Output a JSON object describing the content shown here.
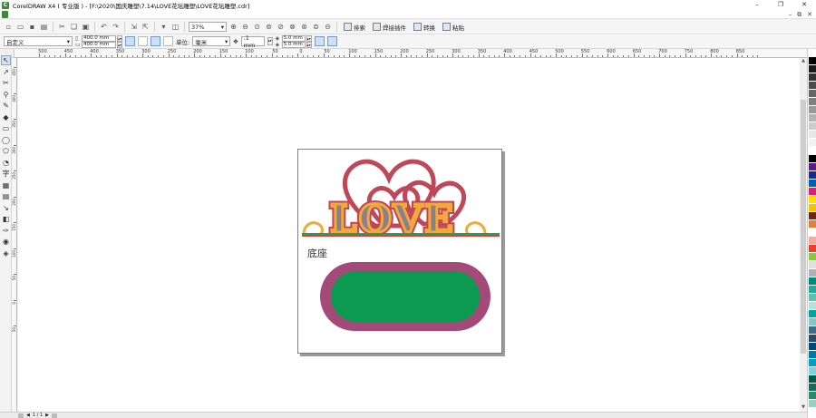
{
  "window": {
    "title": "CorelDRAW X4 ( 专业版 ) - [F:\\2020\\国庆雕塑\\7.14\\LOVE花坛雕塑\\LOVE花坛雕塑.cdr]",
    "app_letter": "C",
    "controls": [
      "–",
      "❐",
      "✕"
    ]
  },
  "menubar": {
    "right_controls": [
      "–",
      "⧉",
      "✕"
    ]
  },
  "toolbar": {
    "zoom": "37%",
    "buttons": [
      "new",
      "open",
      "save",
      "print",
      "cut",
      "copy",
      "paste",
      "undo",
      "redo",
      "import",
      "export",
      "app-launcher",
      "full-screen",
      "zoom-in",
      "zoom-out",
      "zoom-fit",
      "zoom-page",
      "zoom-width",
      "zoom-height",
      "zoom-selected",
      "zoom-all",
      "zoom-drawing",
      "zoom-pan"
    ],
    "arrange_label": "排索",
    "weld_label": "焊接插件",
    "convert_label": "转换",
    "paste_label": "粘贴"
  },
  "propbar": {
    "preset": "自定义",
    "width": "400.0 mm",
    "height": "400.0 mm",
    "units_label": "单位:",
    "units_value": "毫米",
    "nudge": ".1 mm",
    "dup_x": "5.0 mm",
    "dup_y": "5.0 mm"
  },
  "ruler": {
    "h_labels": [
      "500",
      "450",
      "400",
      "350",
      "300",
      "250",
      "200",
      "150",
      "100",
      "50",
      "0",
      "50",
      "100",
      "150",
      "200",
      "250",
      "300",
      "350",
      "400",
      "450",
      "500",
      "550",
      "600",
      "650",
      "700",
      "750",
      "800",
      "850"
    ],
    "v_labels": [
      "450",
      "400",
      "350",
      "300",
      "250",
      "200",
      "150",
      "100",
      "50",
      "0",
      "50"
    ]
  },
  "canvas": {
    "base_label": "底座",
    "love_text": "LOVE",
    "colors": {
      "heart": "#c0465a",
      "letters_fill": "#8a7f8f",
      "letters_stroke": "#f0a93b",
      "letters_outline": "#c0465a",
      "baseline_red": "#d8403a",
      "baseline_green": "#2c9a5a",
      "pill_outer": "#a34a79",
      "pill_inner": "#0b9a4f"
    }
  },
  "palette": {
    "colors": [
      "#ffffff",
      "#000000",
      "#1a1a1a",
      "#333333",
      "#4d4d4d",
      "#666666",
      "#808080",
      "#999999",
      "#b3b3b3",
      "#cccccc",
      "#e6e6e6",
      "#f2f2f2",
      "#ffffff",
      "#000000",
      "#5a1a8a",
      "#1a2a8a",
      "#0060b0",
      "#e01c7a",
      "#ffe000",
      "#f5c400",
      "#6a2a10",
      "#e0803a",
      "#ffffff",
      "#f4a9a0",
      "#e8402a",
      "#8cc63f",
      "#e0e0e0",
      "#b0b0b0",
      "#008a7a",
      "#26a89a",
      "#5fc0b0",
      "#b8e0d8",
      "#00a3a3",
      "#80c8c8",
      "#406a8a",
      "#2a4a6a",
      "#004a7a",
      "#0078a8",
      "#00a0c0",
      "#80d0e0",
      "#005a4a",
      "#1a6a5a",
      "#2a8a6a",
      "#9ad0c0"
    ]
  },
  "status": {
    "items": [
      "◀",
      "▶",
      "1 / 1"
    ]
  }
}
